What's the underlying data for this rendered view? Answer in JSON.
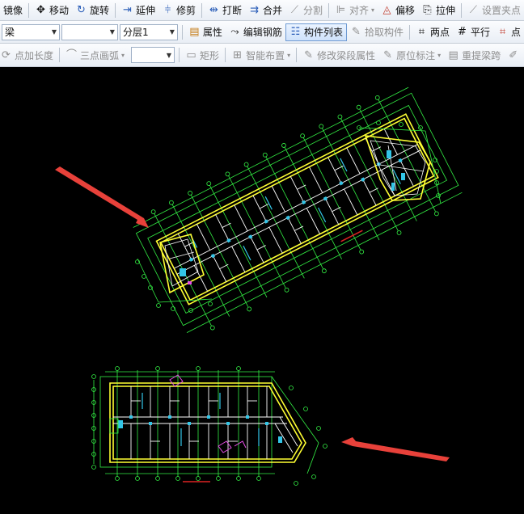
{
  "toolbar1": {
    "mirror": "镜像",
    "move": "移动",
    "rotate": "旋转",
    "extend": "延伸",
    "trim": "修剪",
    "break": "打断",
    "merge": "合并",
    "split": "分割",
    "align": "对齐",
    "offset": "偏移",
    "stretch": "拉伸",
    "set_grip": "设置夹点"
  },
  "toolbar2": {
    "element_type": "梁",
    "blank_select": "",
    "layer_select": "分层1",
    "attributes": "属性",
    "edit_rebar": "编辑钢筋",
    "component_list": "构件列表",
    "pick_component": "拾取构件",
    "two_points": "两点",
    "parallel": "平行",
    "point_angle": "点"
  },
  "toolbar3": {
    "point_add_length": "点加长度",
    "three_point_arc": "三点画弧",
    "shape_select": "",
    "rectangle": "矩形",
    "smart_layout": "智能布置",
    "modify_segment_attr": "修改梁段属性",
    "original_mark": "原位标注",
    "re_extract_span": "重提梁跨"
  },
  "colors": {
    "arrow": "#e8413a",
    "wall": "#ffff33",
    "grid": "#33ee44",
    "detail": "#ffffff",
    "column": "#33c6e8",
    "highlight": "#e84fe8",
    "dim_red": "#dd2222"
  }
}
